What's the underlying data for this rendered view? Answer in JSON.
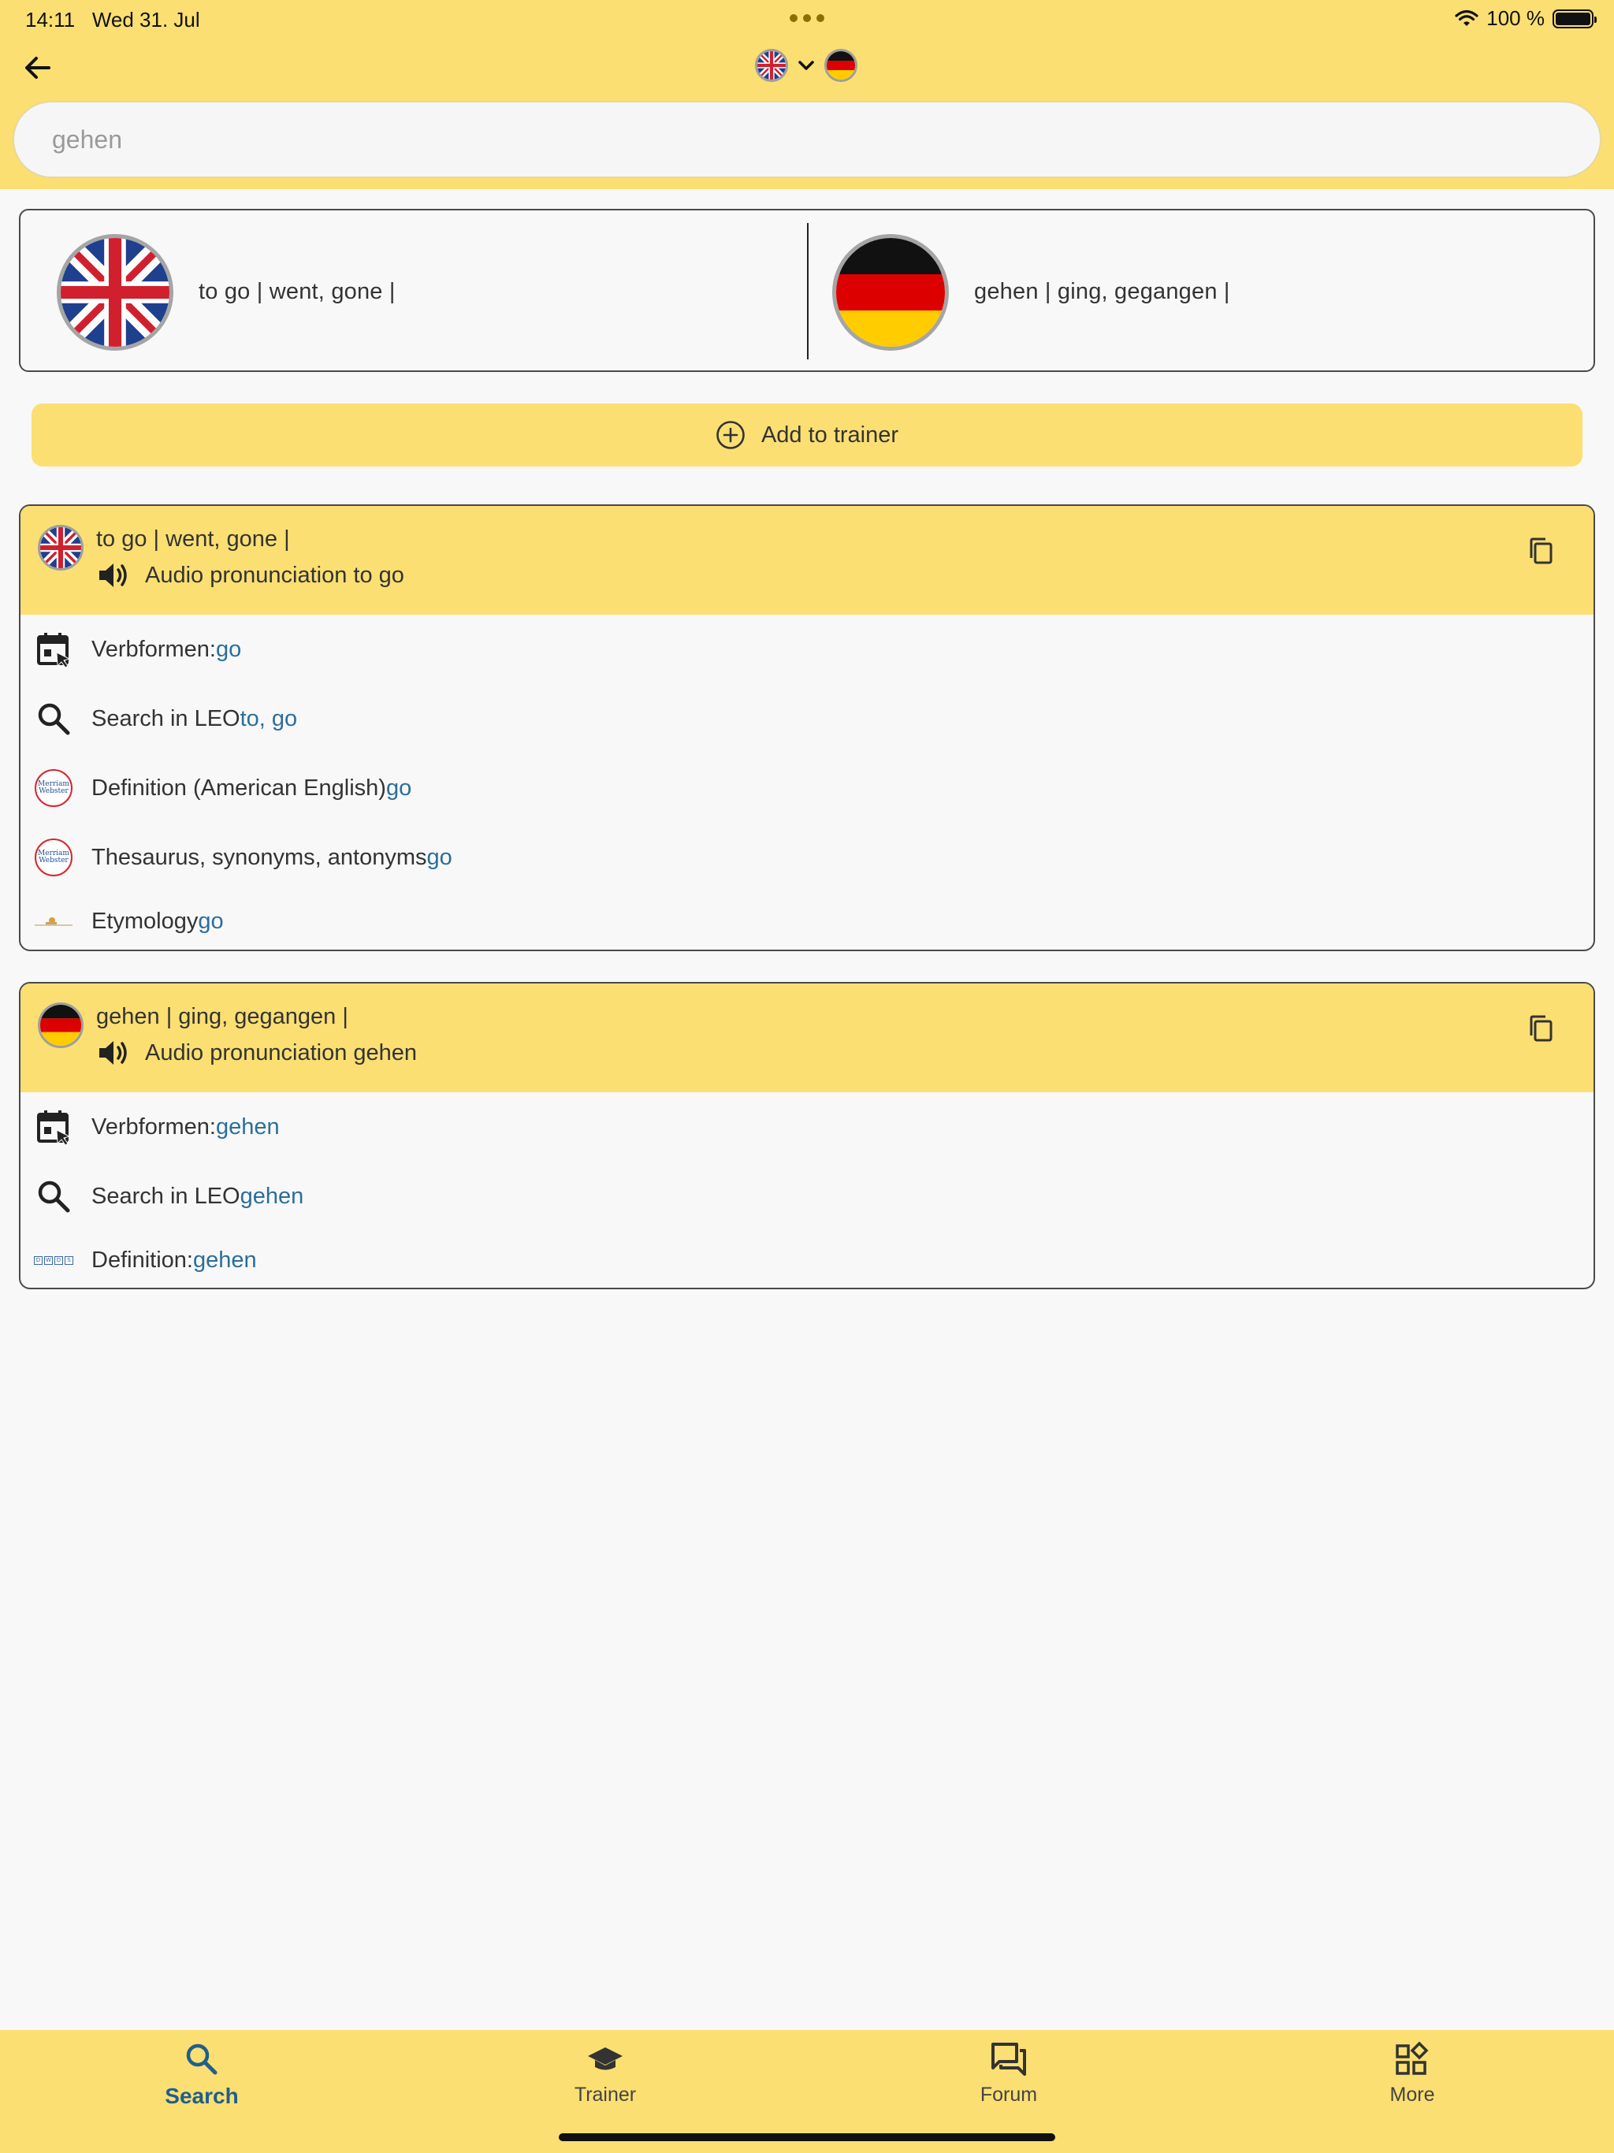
{
  "status": {
    "time": "14:11",
    "date": "Wed 31. Jul",
    "battery": "100 %"
  },
  "header": {
    "source_lang_icon": "uk-flag-icon",
    "target_lang_icon": "germany-flag-icon",
    "search_value": "gehen"
  },
  "summary": {
    "english": "to go  | went, gone |",
    "german": "gehen  | ging, gegangen |"
  },
  "add_button_label": "Add to trainer",
  "entries": [
    {
      "title": "to go  | went, gone |",
      "audio_label": "Audio pronunciation to go",
      "rows": [
        {
          "label": "Verbformen: ",
          "link": "go",
          "icon": "calendar-cursor-icon"
        },
        {
          "label": "Search in LEO ",
          "link": "to, go",
          "icon": "search-icon"
        },
        {
          "label": "Definition (American English) ",
          "link": "go",
          "icon": "merriam-webster-icon"
        },
        {
          "label": "Thesaurus, synonyms, antonyms ",
          "link": "go",
          "icon": "merriam-webster-icon"
        },
        {
          "label": "Etymology ",
          "link": "go",
          "icon": "etymology-icon"
        }
      ]
    },
    {
      "title": "gehen  | ging, gegangen |",
      "audio_label": "Audio pronunciation gehen",
      "rows": [
        {
          "label": "Verbformen: ",
          "link": "gehen",
          "icon": "calendar-cursor-icon"
        },
        {
          "label": "Search in LEO ",
          "link": "gehen",
          "icon": "search-icon"
        },
        {
          "label": "Definition: ",
          "link": "gehen",
          "icon": "dwds-icon"
        }
      ]
    }
  ],
  "mw_logo_text": "Merriam Webster",
  "dwds_letters": [
    "D",
    "W",
    "D",
    "S"
  ],
  "nav": [
    {
      "label": "Search",
      "icon": "search-icon",
      "active": true
    },
    {
      "label": "Trainer",
      "icon": "graduation-cap-icon",
      "active": false
    },
    {
      "label": "Forum",
      "icon": "forum-icon",
      "active": false
    },
    {
      "label": "More",
      "icon": "grid-icon",
      "active": false
    }
  ],
  "colors": {
    "accent_yellow": "#fbdf72",
    "link_blue": "#2b6e9a",
    "active_nav": "#1f5f8b"
  }
}
